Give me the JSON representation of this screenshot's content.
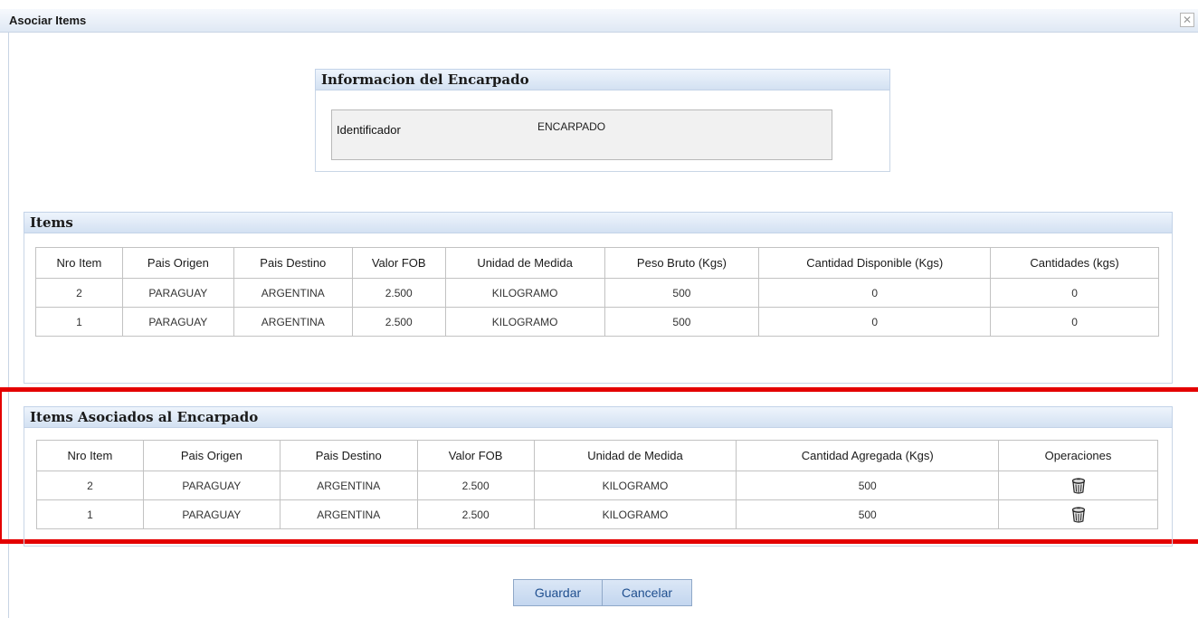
{
  "window": {
    "title": "Asociar Items",
    "close_glyph": "✕"
  },
  "encarpado": {
    "header": "Informacion del Encarpado",
    "label": "Identificador",
    "value": "ENCARPADO"
  },
  "items": {
    "header": "Items",
    "columns": [
      "Nro Item",
      "Pais Origen",
      "Pais Destino",
      "Valor FOB",
      "Unidad de Medida",
      "Peso Bruto (Kgs)",
      "Cantidad Disponible (Kgs)",
      "Cantidades (kgs)"
    ],
    "rows": [
      [
        "2",
        "PARAGUAY",
        "ARGENTINA",
        "2.500",
        "KILOGRAMO",
        "500",
        "0",
        "0"
      ],
      [
        "1",
        "PARAGUAY",
        "ARGENTINA",
        "2.500",
        "KILOGRAMO",
        "500",
        "0",
        "0"
      ]
    ]
  },
  "asociados": {
    "header": "Items Asociados al Encarpado",
    "columns": [
      "Nro Item",
      "Pais Origen",
      "Pais Destino",
      "Valor FOB",
      "Unidad de Medida",
      "Cantidad Agregada (Kgs)",
      "Operaciones"
    ],
    "rows": [
      [
        "2",
        "PARAGUAY",
        "ARGENTINA",
        "2.500",
        "KILOGRAMO",
        "500"
      ],
      [
        "1",
        "PARAGUAY",
        "ARGENTINA",
        "2.500",
        "KILOGRAMO",
        "500"
      ]
    ],
    "row_action_icon": "trash-icon"
  },
  "buttons": {
    "save": "Guardar",
    "cancel": "Cancelar"
  },
  "colors": {
    "highlight": "#e40000",
    "header_bg": "#d3e1f2",
    "button_text": "#1f4f8f"
  }
}
